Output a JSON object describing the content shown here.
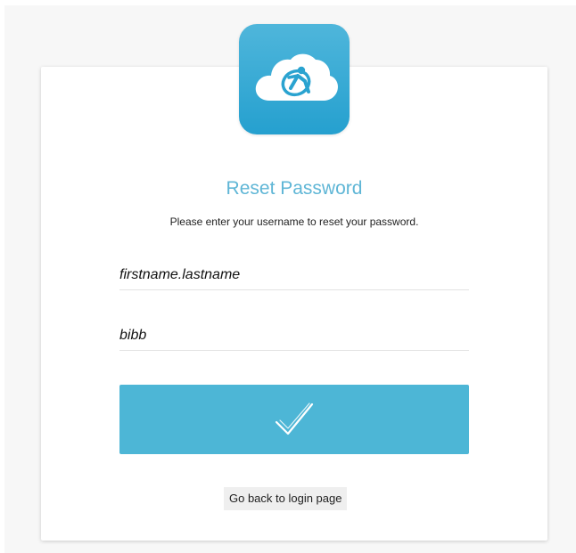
{
  "header": {
    "logo_icon": "cloud-person-logo-icon",
    "accent_color": "#4db6d6"
  },
  "form": {
    "title": "Reset Password",
    "instructions": "Please enter your username to reset your password.",
    "username_value": "firstname.lastname",
    "domain_value": "bibb",
    "submit_icon": "checkmark-icon"
  },
  "footer": {
    "back_link": "Go back to login page"
  }
}
